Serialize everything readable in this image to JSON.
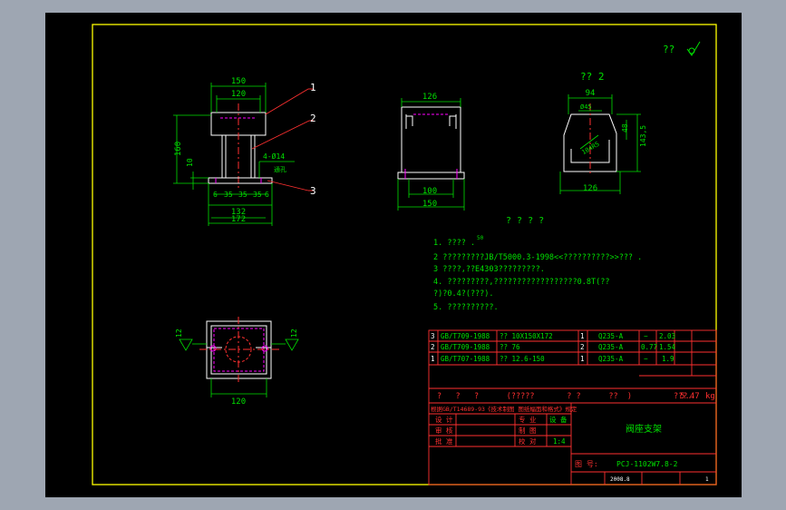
{
  "colors": {
    "paper": "#000000",
    "frame": "#ffff00",
    "dim": "#00e000",
    "part": "#ffffff",
    "hidden": "#ff00ff",
    "leader": "#ff3030",
    "table": "#ff3030"
  },
  "top_right": {
    "roughness": "??"
  },
  "front_view": {
    "dims": {
      "w150": "150",
      "w120": "120",
      "h160": "160",
      "h10": "10",
      "hole": "4-Ø14",
      "hole_sub": "通孔",
      "b6a": "6",
      "b35a": "35",
      "b35b": "35",
      "b35c": "35",
      "b6b": "6",
      "w132": "132",
      "w172": "172"
    },
    "balloons": [
      "1",
      "2",
      "3"
    ]
  },
  "side_view": {
    "dims": {
      "w126": "126",
      "w100": "100",
      "w150": "150"
    }
  },
  "detail_view": {
    "title": "?? 2",
    "dims": {
      "w94": "94",
      "hole_top": "Ø45",
      "r": "104R5",
      "h48": "48",
      "h143": "143,5",
      "w126": "126"
    }
  },
  "notes": {
    "heading": "? ? ? ?",
    "sup": "50",
    "items": [
      "1. ????  .",
      "2  ?????????JB/T5000.3-1998<<??????????>>??? .",
      "3  ????,??E4303?????????.",
      "4.  ?????????,??????????????????0.8T(??",
      "     ?)?0.4?(???).",
      "5.  ??????????."
    ]
  },
  "plan_view": {
    "dims": {
      "left12": "12",
      "right12": "12",
      "w120": "120"
    }
  },
  "bom": {
    "rows": [
      {
        "no": "3",
        "std": "GB/T709-1988",
        "name": "?? 10X150X172",
        "qty": "1",
        "mat": "Q235-A",
        "unit": "−",
        "total": "2.03"
      },
      {
        "no": "2",
        "std": "GB/T709-1988",
        "name": "?? 76",
        "qty": "2",
        "mat": "Q235-A",
        "unit": "0.77",
        "total": "1.54"
      },
      {
        "no": "1",
        "std": "GB/T707-1988",
        "name": "?? 12.6-150",
        "qty": "1",
        "mat": "Q235-A",
        "unit": "−",
        "total": "1.9"
      }
    ],
    "header": "?   ?   ?      (?????       ? ?      ??  )         ???.",
    "weight": "5.47",
    "weight_unit": "kg"
  },
  "title_block": {
    "note_row": "根据GB/T14689-93《技术制图 图纸幅面和格式》规定",
    "rows": [
      "设 计",
      "审 核",
      "批 准"
    ],
    "cols": [
      "专 业",
      "制 图",
      "校 对",
      "标准化",
      "日 期"
    ],
    "values": [
      "设 备",
      "",
      "",
      "",
      "1:4"
    ],
    "drawing_title": "阀座支架",
    "drawing_no_label": "图  号:",
    "drawing_no": "PCJ-1102W7.8-2",
    "bottom": [
      "",
      "2008.8",
      "",
      "1"
    ]
  }
}
